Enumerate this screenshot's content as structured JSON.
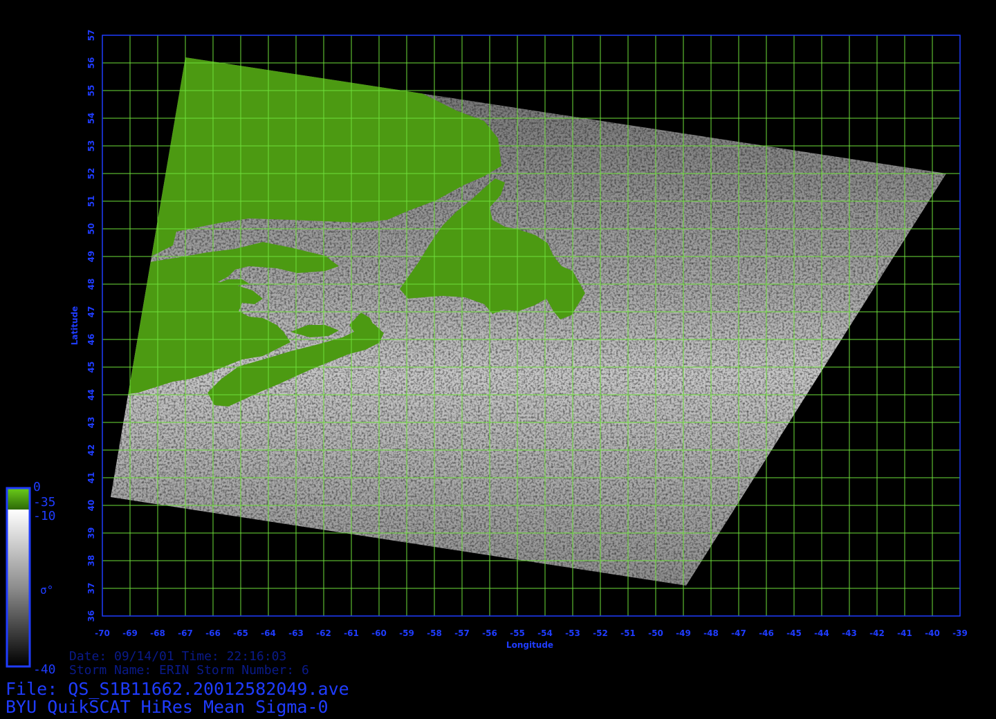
{
  "colors": {
    "background": "#000000",
    "frame": "#1f3cff",
    "label": "#1f3cff",
    "grid": "#6ee03a",
    "land": "#4c9a12",
    "swath": "#8a8a8a"
  },
  "map": {
    "lon_range": [
      -70,
      -39
    ],
    "lat_range": [
      36,
      57
    ],
    "lon_ticks": [
      "-70",
      "-69",
      "-68",
      "-67",
      "-66",
      "-65",
      "-64",
      "-63",
      "-62",
      "-61",
      "-60",
      "-59",
      "-58",
      "-57",
      "-56",
      "-55",
      "-54",
      "-53",
      "-52",
      "-51",
      "-50",
      "-49",
      "-48",
      "-47",
      "-46",
      "-45",
      "-44",
      "-43",
      "-42",
      "-41",
      "-40",
      "-39"
    ],
    "lat_ticks": [
      "36",
      "37",
      "38",
      "39",
      "40",
      "41",
      "42",
      "43",
      "44",
      "45",
      "46",
      "47",
      "48",
      "49",
      "50",
      "51",
      "52",
      "53",
      "54",
      "55",
      "56",
      "57"
    ],
    "xlabel": "Longitude",
    "ylabel": "Latitude",
    "grid": true,
    "swath_corners_lonlat": [
      [
        -67,
        56.2
      ],
      [
        -39.5,
        52
      ],
      [
        -48.9,
        37.1
      ],
      [
        -69.7,
        40.3
      ]
    ],
    "land_regions": [
      "Labrador",
      "Quebec",
      "Newfoundland",
      "New Brunswick",
      "Nova Scotia",
      "Prince Edward Island",
      "Maine"
    ]
  },
  "colorbar": {
    "land_top": "0",
    "land_bottom": "-35",
    "top": "-10",
    "symbol": "σ°",
    "bottom": "-40"
  },
  "info": {
    "date_line": "Date: 09/14/01   Time: 22:16:03",
    "storm_line": "Storm  Name: ERIN   Storm  Number: 6",
    "file_line": "File: QS_S1B11662.20012582049.ave",
    "product_line": "BYU  QuikSCAT  HiRes  Mean  Sigma-0"
  }
}
